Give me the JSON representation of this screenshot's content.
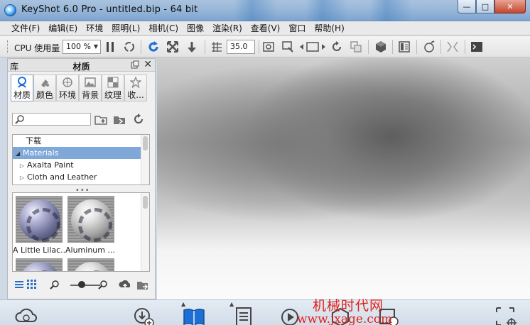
{
  "window": {
    "title": "KeyShot 6.0 Pro  - untitled.bip  - 64 bit",
    "controls": {
      "minimize": "—",
      "maximize": "□",
      "close": "✕"
    }
  },
  "menubar": {
    "items": [
      "文件(F)",
      "编辑(E)",
      "环境",
      "照明(L)",
      "相机(C)",
      "图像",
      "渲染(R)",
      "查看(V)",
      "窗口",
      "帮助(H)"
    ]
  },
  "toolbar": {
    "cpu_label": "CPU 使用量",
    "cpu_value": "100 %",
    "fov_value": "35.0",
    "icons": [
      "pause-icon",
      "spin-icon",
      "refresh-icon",
      "fit-view-icon",
      "down-arrow-icon",
      "grid-icon",
      "screenshot-icon",
      "render-region-icon",
      "camera-prev-icon",
      "reset-icon",
      "copy-icon",
      "material-icon",
      "layout-icon",
      "animation-icon",
      "split-icon",
      "console-icon"
    ]
  },
  "library_panel": {
    "lib_label": "库",
    "title": "材质",
    "tabs": [
      {
        "label": "材质",
        "icon": "material-tab-icon",
        "active": true
      },
      {
        "label": "颜色",
        "icon": "color-tab-icon",
        "active": false
      },
      {
        "label": "环境",
        "icon": "environment-tab-icon",
        "active": false
      },
      {
        "label": "背景",
        "icon": "background-tab-icon",
        "active": false
      },
      {
        "label": "纹理",
        "icon": "texture-tab-icon",
        "active": false
      },
      {
        "label": "收...",
        "icon": "favorites-tab-icon",
        "active": false
      }
    ],
    "search": {
      "placeholder": "",
      "value": ""
    },
    "tree": [
      {
        "label": "下载",
        "indent": 1,
        "arrow": "",
        "selected": false
      },
      {
        "label": "Materials",
        "indent": 0,
        "arrow": "◢",
        "selected": true
      },
      {
        "label": "Axalta Paint",
        "indent": 1,
        "arrow": "▷",
        "selected": false
      },
      {
        "label": "Cloth and Leather",
        "indent": 1,
        "arrow": "▷",
        "selected": false
      }
    ],
    "materials": [
      {
        "label": "A Little Lilac...",
        "style": "lilac"
      },
      {
        "label": "Aluminum ...",
        "style": "alu"
      }
    ]
  },
  "ribbon": {
    "icons": [
      "cloud-library-icon",
      "import-icon",
      "library-icon",
      "project-icon",
      "animation-icon",
      "keyshotvr-icon",
      "render-icon",
      "screenshot-icon"
    ]
  },
  "watermark": {
    "line1": "机械时代网",
    "line2": "www.jxage.com"
  }
}
